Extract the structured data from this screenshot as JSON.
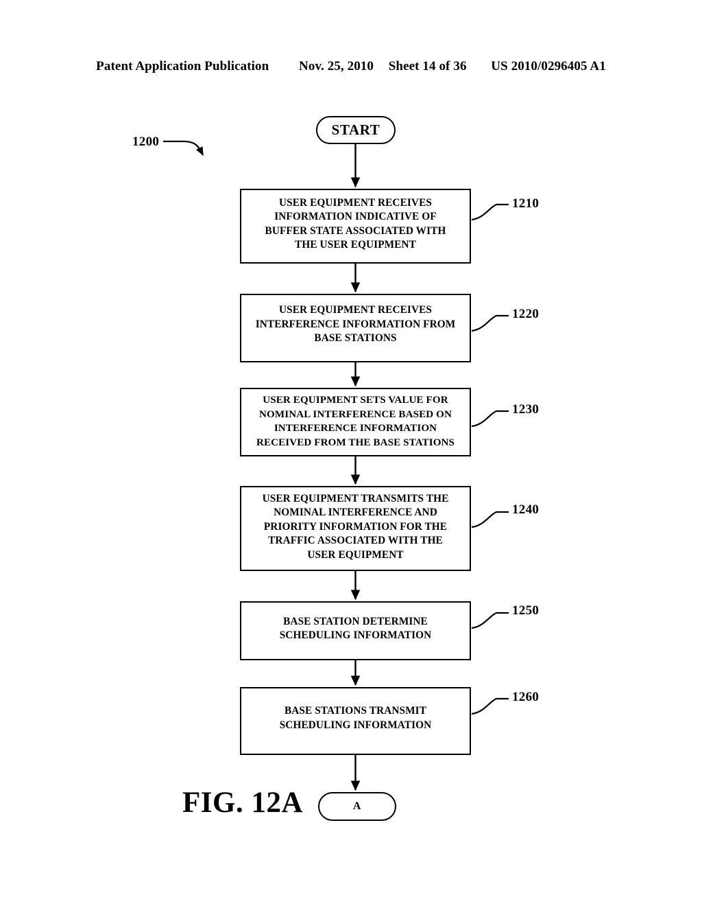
{
  "header": {
    "publication": "Patent Application Publication",
    "date": "Nov. 25, 2010",
    "sheet": "Sheet 14 of 36",
    "patent_number": "US 2010/0296405 A1"
  },
  "figure": {
    "caption": "FIG. 12A",
    "diagram_numeral": "1200"
  },
  "nodes": {
    "start": {
      "label": "START"
    },
    "connector_a": {
      "label": "A"
    }
  },
  "steps": [
    {
      "numeral": "1210",
      "text": "USER EQUIPMENT RECEIVES\nINFORMATION INDICATIVE OF\nBUFFER STATE ASSOCIATED WITH\nTHE USER EQUIPMENT"
    },
    {
      "numeral": "1220",
      "text": "USER EQUIPMENT RECEIVES\nINTERFERENCE INFORMATION FROM\nBASE STATIONS"
    },
    {
      "numeral": "1230",
      "text": "USER EQUIPMENT SETS VALUE FOR\nNOMINAL INTERFERENCE BASED ON\nINTERFERENCE INFORMATION\nRECEIVED FROM THE BASE STATIONS"
    },
    {
      "numeral": "1240",
      "text": "USER EQUIPMENT TRANSMITS THE\nNOMINAL INTERFERENCE AND\nPRIORITY INFORMATION FOR THE\nTRAFFIC ASSOCIATED WITH THE\nUSER EQUIPMENT"
    },
    {
      "numeral": "1250",
      "text": "BASE STATION DETERMINE\nSCHEDULING INFORMATION"
    },
    {
      "numeral": "1260",
      "text": "BASE STATIONS TRANSMIT\nSCHEDULING INFORMATION"
    }
  ],
  "colors": {
    "ink": "#000000",
    "paper": "#ffffff"
  }
}
